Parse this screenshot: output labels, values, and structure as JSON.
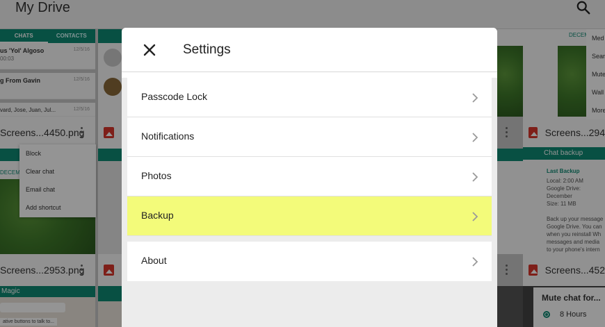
{
  "app": {
    "title": "My Drive"
  },
  "background": {
    "whatsapp_tabs": [
      "CHATS",
      "CONTACTS"
    ],
    "chats": [
      {
        "name": "us 'Yol' Algoso",
        "sub": "00:03",
        "date": "12/5/16"
      },
      {
        "name": "g From Gavin",
        "sub": "",
        "date": "12/5/16"
      },
      {
        "name": "vard, Jose, Juan, Jul...",
        "sub": "",
        "date": "12/5/16"
      }
    ],
    "context_menu": [
      "Block",
      "Clear chat",
      "Email chat",
      "Add shortcut"
    ],
    "right_menu": [
      "Med",
      "Sear",
      "Mute",
      "Wall",
      "More"
    ],
    "files": [
      {
        "name": "Screens...4450.png"
      },
      {
        "name": "Screens...294"
      },
      {
        "name": "Screens...2953.png"
      },
      {
        "name": "Screens...452"
      }
    ],
    "chat_backup": {
      "title": "Chat backup",
      "last_backup_label": "Last Backup",
      "lines": [
        "Local: 2:00 AM",
        "Google Drive: December",
        "Size: 11 MB",
        "",
        "Back up your message",
        "Google Drive. You can",
        "when you reinstall Wh",
        "messages and media",
        "to your phone's intern"
      ]
    },
    "mute": {
      "title": "Mute chat for...",
      "option": "8 Hours"
    },
    "magic_label": "Magic",
    "decem_label": "DECEM",
    "misc_snippet": "ative buttons to talk to..."
  },
  "settings": {
    "title": "Settings",
    "items": [
      {
        "label": "Passcode Lock"
      },
      {
        "label": "Notifications"
      },
      {
        "label": "Photos"
      },
      {
        "label": "Backup",
        "highlighted": true
      },
      {
        "label": "About"
      }
    ]
  },
  "colors": {
    "highlight": "#f3fb7a",
    "whatsapp_green": "#0f8a74",
    "image_icon_red": "#d9362b"
  }
}
